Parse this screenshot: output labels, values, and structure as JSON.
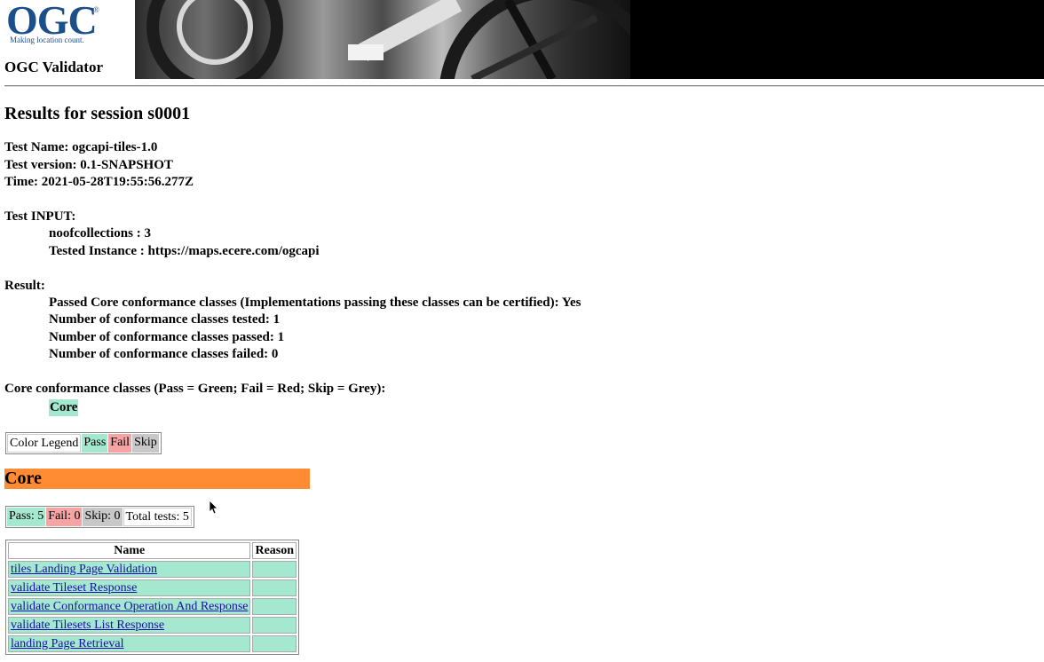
{
  "header": {
    "logo_text": "OGC",
    "logo_registered": "®",
    "logo_tagline": "Making location count.",
    "app_title": "OGC Validator"
  },
  "session": {
    "heading": "Results for session s0001",
    "test_name": "Test Name: ogcapi-tiles-1.0",
    "test_version": "Test version: 0.1-SNAPSHOT",
    "time": "Time: 2021-05-28T19:55:56.277Z"
  },
  "input": {
    "label": "Test INPUT:",
    "noofcollections": "noofcollections : 3",
    "tested_instance": "Tested Instance : https://maps.ecere.com/ogcapi"
  },
  "result": {
    "label": "Result:",
    "passed_core": "Passed Core conformance classes (Implementations passing these classes can be certified): Yes",
    "tested": "Number of conformance classes tested: 1",
    "passed": "Number of conformance classes passed: 1",
    "failed": "Number of conformance classes failed: 0"
  },
  "conformance": {
    "heading": "Core conformance classes (Pass = Green; Fail = Red; Skip = Grey):",
    "core_chip": "Core"
  },
  "legend": {
    "label": "Color Legend",
    "pass": "Pass",
    "fail": "Fail",
    "skip": "Skip"
  },
  "core_section": {
    "title": "Core",
    "pass": "Pass: 5",
    "fail": "Fail: 0",
    "skip": "Skip: 0",
    "total": "Total tests: 5"
  },
  "table": {
    "headers": {
      "name": "Name",
      "reason": "Reason"
    },
    "rows": [
      {
        "name": "tiles Landing Page Validation",
        "reason": ""
      },
      {
        "name": "validate Tileset Response",
        "reason": ""
      },
      {
        "name": "validate Conformance Operation And Response",
        "reason": ""
      },
      {
        "name": "validate Tilesets List Response",
        "reason": ""
      },
      {
        "name": "landing Page Retrieval",
        "reason": ""
      }
    ]
  },
  "colors": {
    "pass": "#a3e8cf",
    "fail": "#f5a3a3",
    "skip": "#c8c8c8",
    "section_bar": "#ff8c33",
    "logo": "#1a4f8a"
  }
}
